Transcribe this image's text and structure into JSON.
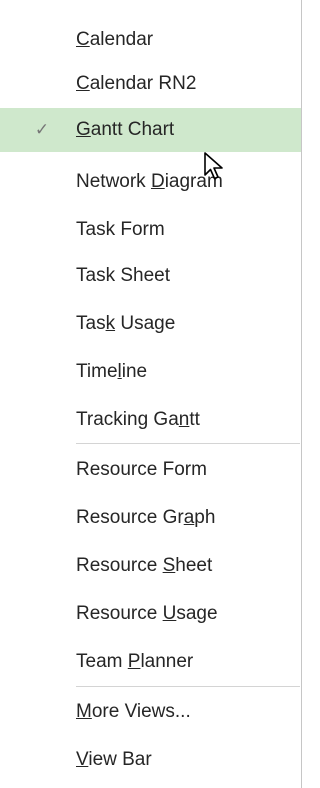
{
  "check_glyph": "✓",
  "items": [
    {
      "name": "menu-item-calendar",
      "before": "",
      "key": "C",
      "after": "alendar",
      "checked": false
    },
    {
      "name": "menu-item-calendar-rn2",
      "before": "",
      "key": "C",
      "after": "alendar RN2",
      "checked": false
    },
    {
      "name": "menu-item-gantt-chart",
      "before": "",
      "key": "G",
      "after": "antt Chart",
      "checked": true
    },
    {
      "name": "menu-item-network-diagram",
      "before": "Network ",
      "key": "D",
      "after": "iagram",
      "checked": false
    },
    {
      "name": "menu-item-task-form",
      "before": "Task Form",
      "key": "",
      "after": "",
      "checked": false
    },
    {
      "name": "menu-item-task-sheet",
      "before": "Task Sheet",
      "key": "",
      "after": "",
      "checked": false
    },
    {
      "name": "menu-item-task-usage",
      "before": "Tas",
      "key": "k",
      "after": " Usage",
      "checked": false
    },
    {
      "name": "menu-item-timeline",
      "before": "Time",
      "key": "l",
      "after": "ine",
      "checked": false
    },
    {
      "name": "menu-item-tracking-gantt",
      "before": "Tracking Ga",
      "key": "n",
      "after": "tt",
      "checked": false
    },
    {
      "name": "menu-item-resource-form",
      "before": "Resource Form",
      "key": "",
      "after": "",
      "checked": false
    },
    {
      "name": "menu-item-resource-graph",
      "before": "Resource Gr",
      "key": "a",
      "after": "ph",
      "checked": false
    },
    {
      "name": "menu-item-resource-sheet",
      "before": "Resource ",
      "key": "S",
      "after": "heet",
      "checked": false
    },
    {
      "name": "menu-item-resource-usage",
      "before": "Resource ",
      "key": "U",
      "after": "sage",
      "checked": false
    },
    {
      "name": "menu-item-team-planner",
      "before": "Team ",
      "key": "P",
      "after": "lanner",
      "checked": false
    },
    {
      "name": "menu-item-more-views",
      "before": "",
      "key": "M",
      "after": "ore Views...",
      "checked": false
    },
    {
      "name": "menu-item-view-bar",
      "before": "",
      "key": "V",
      "after": "iew Bar",
      "checked": false
    }
  ],
  "colors": {
    "checked_background": "#cfe8cc",
    "text": "#262626",
    "separator": "#d4d4d4"
  }
}
